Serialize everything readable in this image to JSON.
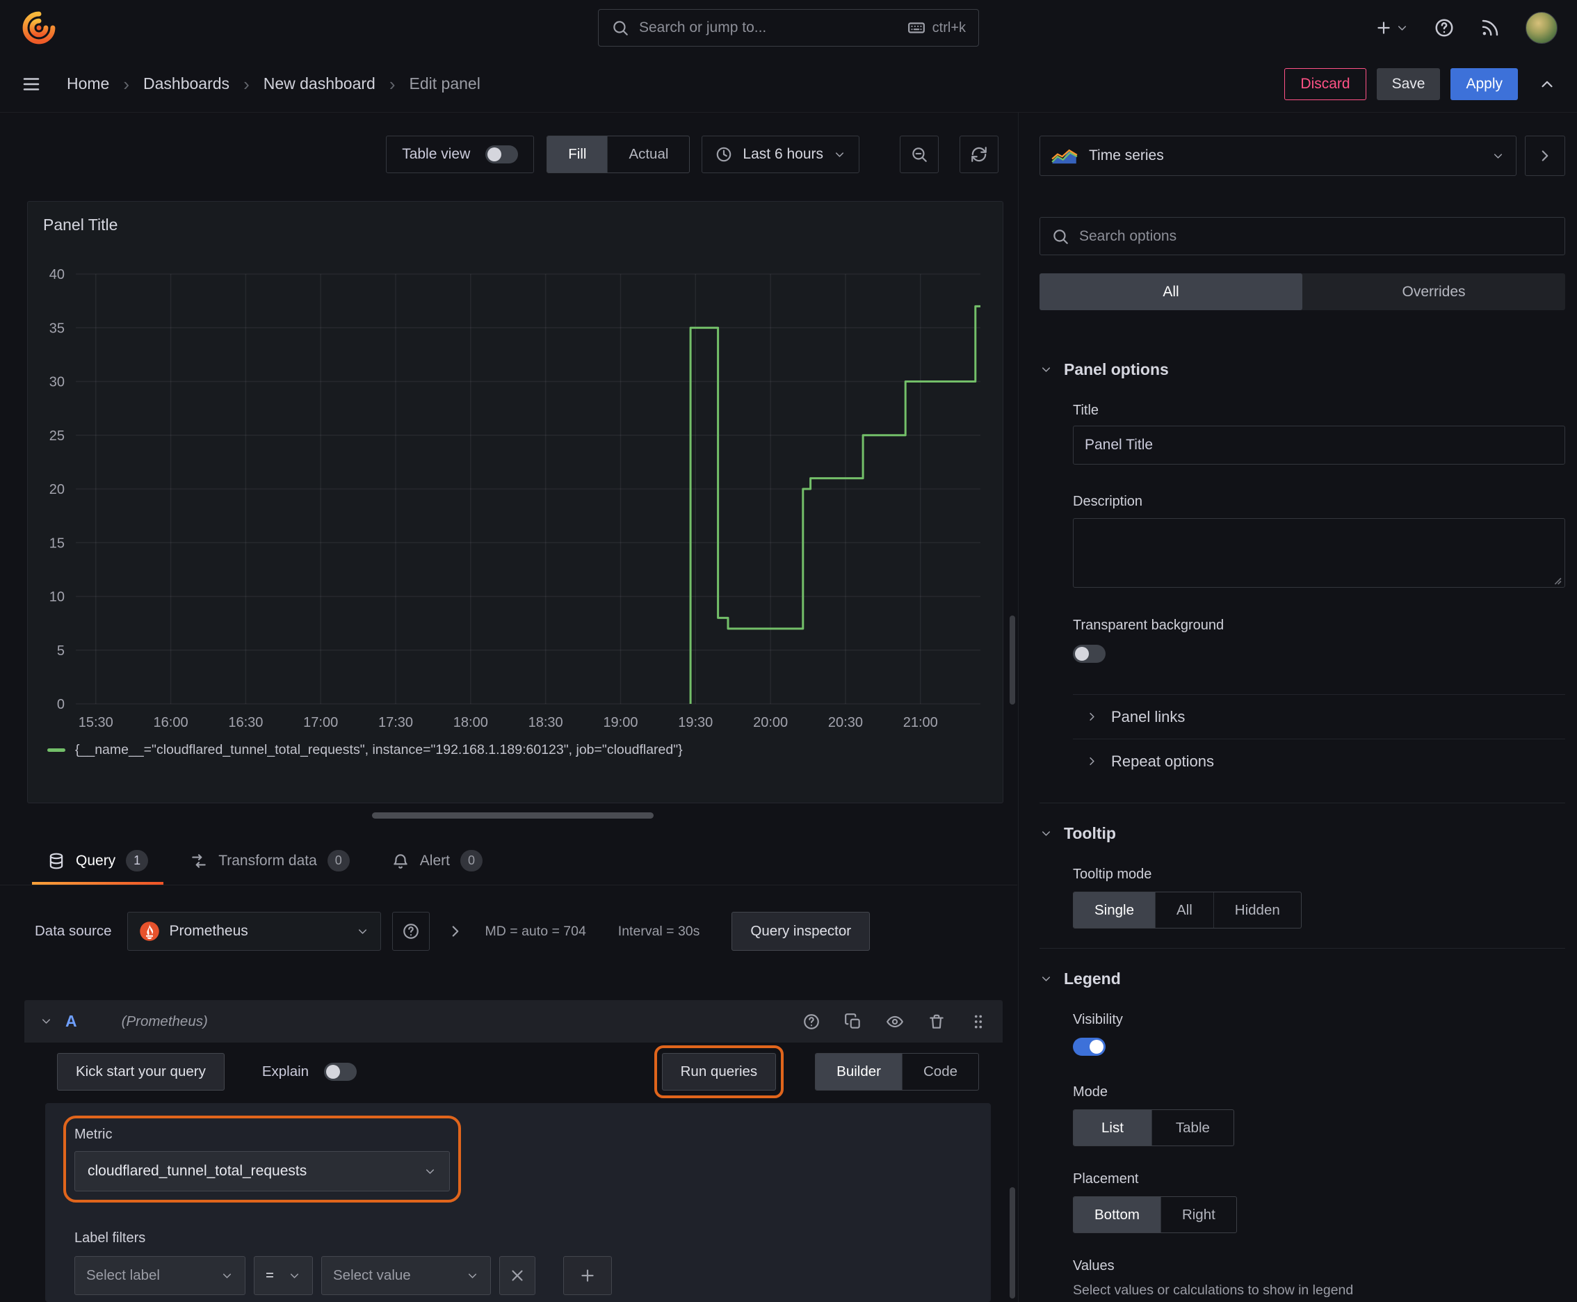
{
  "colors": {
    "highlight_orange": "#e0651c",
    "series_green": "#73bf69",
    "primary_blue": "#3d71d9",
    "danger_red": "#ff5286"
  },
  "topbar": {
    "search_placeholder": "Search or jump to...",
    "shortcut": "ctrl+k"
  },
  "breadcrumbs": {
    "items": [
      "Home",
      "Dashboards",
      "New dashboard",
      "Edit panel"
    ],
    "discard": "Discard",
    "save": "Save",
    "apply": "Apply"
  },
  "toolbar": {
    "table_view": "Table view",
    "fill": "Fill",
    "actual": "Actual",
    "time_range": "Last 6 hours"
  },
  "panel": {
    "title": "Panel Title"
  },
  "chart_data": {
    "type": "line",
    "title": "Panel Title",
    "xlabel": "",
    "ylabel": "",
    "ylim": [
      0,
      40
    ],
    "y_ticks": [
      0,
      5,
      10,
      15,
      20,
      25,
      30,
      35,
      40
    ],
    "x_ticks": [
      "15:30",
      "16:00",
      "16:30",
      "17:00",
      "17:30",
      "18:00",
      "18:30",
      "19:00",
      "19:30",
      "20:00",
      "20:30",
      "21:00"
    ],
    "x_domain_minutes": [
      922,
      1284
    ],
    "grid": true,
    "legend_position": "bottom",
    "series": [
      {
        "name": "{__name__=\"cloudflared_tunnel_total_requests\", instance=\"192.168.1.189:60123\", job=\"cloudflared\"}",
        "color": "#73bf69",
        "points": [
          [
            1168,
            0
          ],
          [
            1168,
            35
          ],
          [
            1179,
            35
          ],
          [
            1179,
            8
          ],
          [
            1183,
            8
          ],
          [
            1183,
            7
          ],
          [
            1213,
            7
          ],
          [
            1213,
            20
          ],
          [
            1216,
            20
          ],
          [
            1216,
            21
          ],
          [
            1237,
            21
          ],
          [
            1237,
            25
          ],
          [
            1254,
            25
          ],
          [
            1254,
            30
          ],
          [
            1282,
            30
          ],
          [
            1282,
            37
          ],
          [
            1284,
            37
          ]
        ]
      }
    ]
  },
  "tabs": {
    "query": "Query",
    "query_count": "1",
    "transform": "Transform data",
    "transform_count": "0",
    "alert": "Alert",
    "alert_count": "0"
  },
  "query": {
    "data_source_label": "Data source",
    "data_source_value": "Prometheus",
    "stats_md": "MD = auto = 704",
    "stats_interval": "Interval = 30s",
    "query_inspector": "Query inspector",
    "ref_id": "A",
    "ds_hint": "(Prometheus)",
    "kick_start": "Kick start your query",
    "explain": "Explain",
    "run_queries": "Run queries",
    "builder": "Builder",
    "code": "Code",
    "metric_label": "Metric",
    "metric_value": "cloudflared_tunnel_total_requests",
    "label_filters": "Label filters",
    "select_label": "Select label",
    "operator": "=",
    "select_value": "Select value"
  },
  "sidebar": {
    "viz_name": "Time series",
    "search_placeholder": "Search options",
    "tab_all": "All",
    "tab_overrides": "Overrides",
    "panel_options": {
      "header": "Panel options",
      "title_label": "Title",
      "title_value": "Panel Title",
      "description_label": "Description",
      "transparent_bg": "Transparent background",
      "panel_links": "Panel links",
      "repeat_options": "Repeat options"
    },
    "tooltip": {
      "header": "Tooltip",
      "mode_label": "Tooltip mode",
      "options": [
        "Single",
        "All",
        "Hidden"
      ]
    },
    "legend": {
      "header": "Legend",
      "visibility": "Visibility",
      "mode_label": "Mode",
      "mode_options": [
        "List",
        "Table"
      ],
      "placement_label": "Placement",
      "placement_options": [
        "Bottom",
        "Right"
      ],
      "values_label": "Values",
      "values_help": "Select values or calculations to show in legend"
    }
  }
}
